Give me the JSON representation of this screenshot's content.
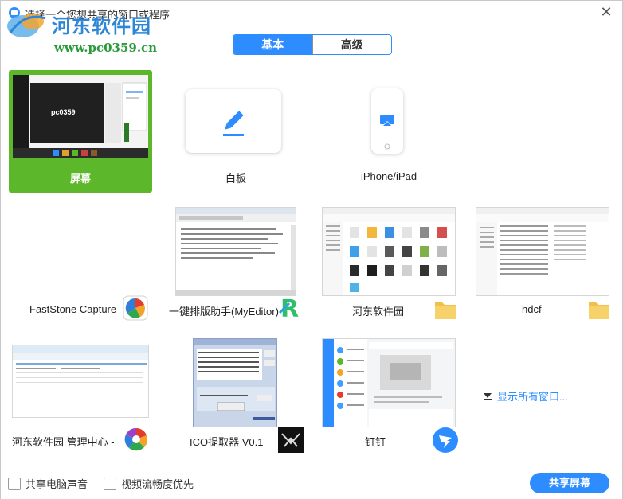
{
  "window": {
    "title": "选择一个您想共享的窗口或程序"
  },
  "watermark": {
    "brand": "河东软件园",
    "site": "www.pc0359.cn"
  },
  "tabs": [
    {
      "label": "基本",
      "active": true
    },
    {
      "label": "高级",
      "active": false
    }
  ],
  "tiles": {
    "screen": {
      "label": "屏幕",
      "thumb_text": "pc0359",
      "selected": true
    },
    "whiteboard": {
      "label": "白板"
    },
    "iphone": {
      "label": "iPhone/iPad"
    },
    "faststone": {
      "label": "FastStone Capture"
    },
    "myeditor": {
      "label": "一键排版助手(MyEditor)"
    },
    "hedong": {
      "label": "河东软件园"
    },
    "hdcf": {
      "label": "hdcf"
    },
    "hedong_admin": {
      "label": "河东软件园 管理中心 -"
    },
    "ico": {
      "label": "ICO提取器 V0.1",
      "thumb_btn": "开始提取"
    },
    "dingding": {
      "label": "钉钉"
    }
  },
  "show_all": {
    "label": "显示所有窗口..."
  },
  "bottom": {
    "share_audio": {
      "label": "共享电脑声音",
      "checked": false
    },
    "video_smooth": {
      "label": "视频流畅度优先",
      "checked": false
    },
    "share_button": "共享屏幕"
  },
  "colors": {
    "accent": "#2d8cff",
    "selected_tile": "#5cb82a"
  }
}
